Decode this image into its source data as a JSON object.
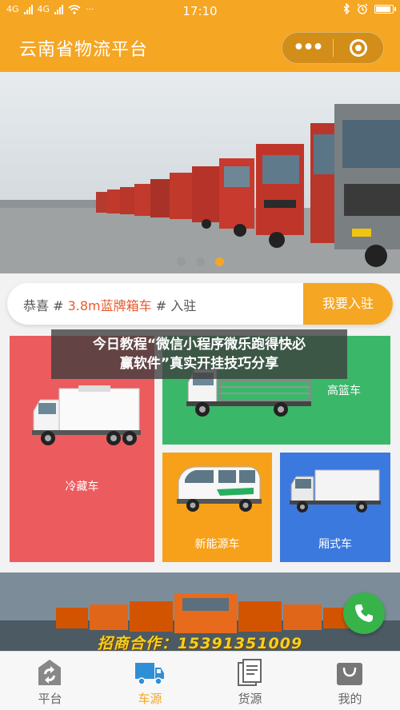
{
  "status_bar": {
    "network_1": "4G",
    "network_2": "4G",
    "more": "···",
    "time": "17:10"
  },
  "title_bar": {
    "title": "云南省物流平台",
    "more_label": "•••"
  },
  "banner": {
    "dots": 3,
    "active_dot": 3
  },
  "notice": {
    "prefix": "恭喜 # ",
    "highlight": "3.8m蓝牌箱车",
    "suffix": " # 入驻",
    "button": "我要入驻"
  },
  "tiles": {
    "cold": "冷藏车",
    "basket": "高篮车",
    "ev": "新能源车",
    "box": "厢式车"
  },
  "overlay": {
    "line1": "今日教程“微信小程序微乐跑得快必",
    "line2": "赢软件”真实开挂技巧分享"
  },
  "ad": {
    "text": "招商合作：15391351009"
  },
  "tabs": [
    {
      "label": "平台",
      "icon": "refresh-box-icon"
    },
    {
      "label": "车源",
      "icon": "truck-icon"
    },
    {
      "label": "货源",
      "icon": "document-icon"
    },
    {
      "label": "我的",
      "icon": "bag-icon"
    }
  ],
  "colors": {
    "brand": "#f5a623",
    "cold": "#ec5b5e",
    "basket": "#3bb76a",
    "ev": "#f7a11a",
    "box": "#3b79de",
    "highlight": "#e85a2c"
  }
}
